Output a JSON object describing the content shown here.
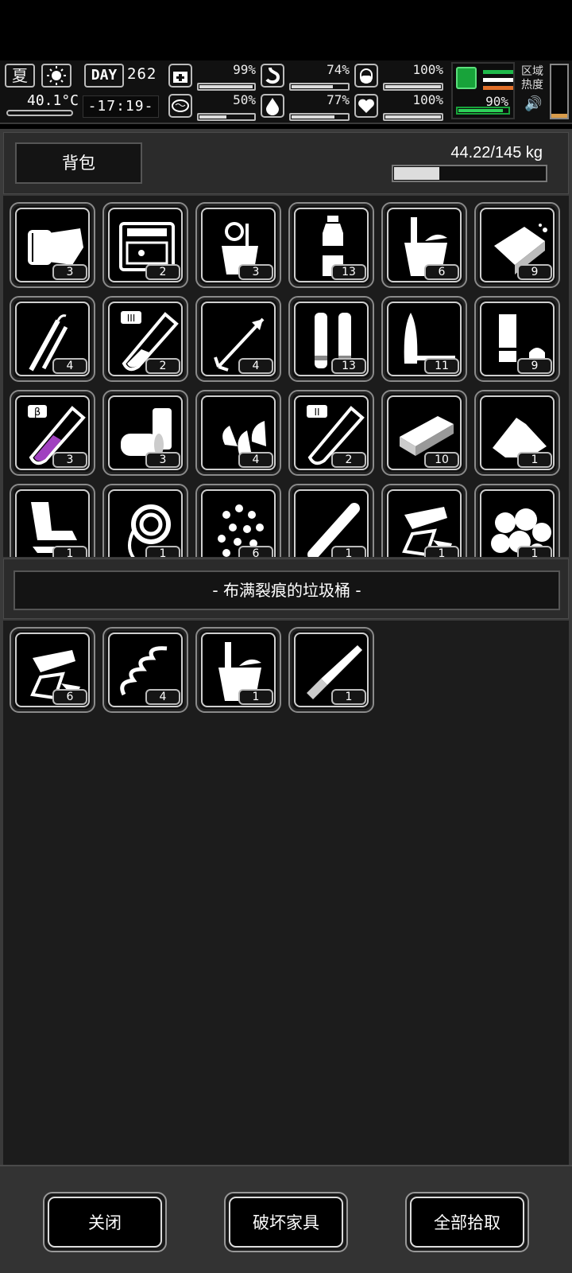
{
  "hud": {
    "season": "夏",
    "temperature": "40.1°C",
    "day_label": "DAY",
    "day_number": "262",
    "clock": "-17:19-",
    "stats": [
      {
        "name": "health",
        "value": "99%",
        "fill": 0.99
      },
      {
        "name": "hunger",
        "value": "74%",
        "fill": 0.74
      },
      {
        "name": "stamina",
        "value": "100%",
        "fill": 1.0
      },
      {
        "name": "mental",
        "value": "50%",
        "fill": 0.5
      },
      {
        "name": "thirst",
        "value": "77%",
        "fill": 0.77
      },
      {
        "name": "heart",
        "value": "100%",
        "fill": 1.0
      }
    ],
    "movement": {
      "value": "90%",
      "fill": 0.9
    },
    "region_heat_label": "区域热度",
    "stripe_colors": [
      "#1fb84a",
      "#ffffff",
      "#e0702a"
    ],
    "heat_fill": 0.08
  },
  "inventory": {
    "title": "背包",
    "weight": "44.22/145 kg",
    "weight_fill": 0.3,
    "items": [
      {
        "icon": "bandage-icon",
        "count": "3"
      },
      {
        "icon": "toolbox-icon",
        "count": "2"
      },
      {
        "icon": "tool-cup-icon",
        "count": "3"
      },
      {
        "icon": "water-bottle-icon",
        "count": "13"
      },
      {
        "icon": "bucket-icon",
        "count": "6"
      },
      {
        "icon": "soap-bar-icon",
        "count": "9"
      },
      {
        "icon": "tweezers-icon",
        "count": "4"
      },
      {
        "icon": "test-tube-iii-icon",
        "count": "2"
      },
      {
        "icon": "arrow-icon",
        "count": "4"
      },
      {
        "icon": "shotgun-shells-icon",
        "count": "13"
      },
      {
        "icon": "bullet-icon",
        "count": "11"
      },
      {
        "icon": "battery-icon",
        "count": "9"
      },
      {
        "icon": "test-tube-beta-icon",
        "count": "3"
      },
      {
        "icon": "tin-cans-icon",
        "count": "3"
      },
      {
        "icon": "rounds-icon",
        "count": "4"
      },
      {
        "icon": "test-tube-ii-icon",
        "count": "2"
      },
      {
        "icon": "plank-icon",
        "count": "10"
      },
      {
        "icon": "powder-pile-icon",
        "count": "1"
      },
      {
        "icon": "scrap-icon",
        "count": "1"
      },
      {
        "icon": "rope-icon",
        "count": "1"
      },
      {
        "icon": "pellets-icon",
        "count": "6"
      },
      {
        "icon": "pipe-icon",
        "count": "1"
      },
      {
        "icon": "glass-shards-icon",
        "count": "1"
      },
      {
        "icon": "stones-icon",
        "count": "1"
      }
    ]
  },
  "container": {
    "title": "- 布满裂痕的垃圾桶 -",
    "items": [
      {
        "icon": "glass-shards-icon",
        "count": "6"
      },
      {
        "icon": "spring-icon",
        "count": "4"
      },
      {
        "icon": "bucket-icon",
        "count": "1"
      },
      {
        "icon": "knife-icon",
        "count": "1"
      }
    ]
  },
  "footer": {
    "close_label": "关闭",
    "destroy_label": "破坏家具",
    "take_all_label": "全部拾取"
  }
}
